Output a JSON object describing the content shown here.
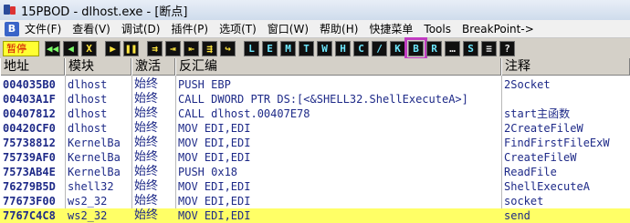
{
  "title": "15PBOD - dlhost.exe - [断点]",
  "menu": {
    "b_label": "B",
    "items": [
      "文件(F)",
      "查看(V)",
      "调试(D)",
      "插件(P)",
      "选项(T)",
      "窗口(W)",
      "帮助(H)",
      "快捷菜单",
      "Tools",
      "BreakPoint->"
    ]
  },
  "toolbar": {
    "status": "暂停",
    "buttons_left": [
      "◀◀",
      "◀",
      "X",
      "▶",
      "❚❚",
      "⇉",
      "⇥",
      "⇤",
      "⇶",
      "↪"
    ],
    "buttons_right": [
      "L",
      "E",
      "M",
      "T",
      "W",
      "H",
      "C",
      "/",
      "K",
      "B",
      "R",
      "…",
      "S",
      "≡",
      "?"
    ]
  },
  "table": {
    "headers": [
      "地址",
      "模块",
      "激活",
      "反汇编",
      "注释"
    ],
    "rows": [
      {
        "addr": "004035B0",
        "module": "dlhost",
        "active": "始终",
        "disasm": "PUSH EBP",
        "comment": "2Socket"
      },
      {
        "addr": "00403A1F",
        "module": "dlhost",
        "active": "始终",
        "disasm": "CALL DWORD PTR DS:[<&SHELL32.ShellExecuteA>]",
        "comment": ""
      },
      {
        "addr": "00407812",
        "module": "dlhost",
        "active": "始终",
        "disasm": "CALL dlhost.00407E78",
        "comment": "start主函数"
      },
      {
        "addr": "00420CF0",
        "module": "dlhost",
        "active": "始终",
        "disasm": "MOV EDI,EDI",
        "comment": "2CreateFileW"
      },
      {
        "addr": "75738812",
        "module": "KernelBa",
        "active": "始终",
        "disasm": "MOV EDI,EDI",
        "comment": "FindFirstFileExW"
      },
      {
        "addr": "75739AF0",
        "module": "KernelBa",
        "active": "始终",
        "disasm": "MOV EDI,EDI",
        "comment": "CreateFileW"
      },
      {
        "addr": "7573AB4E",
        "module": "KernelBa",
        "active": "始终",
        "disasm": "PUSH 0x18",
        "comment": "ReadFile"
      },
      {
        "addr": "76279B5D",
        "module": "shell32",
        "active": "始终",
        "disasm": "MOV EDI,EDI",
        "comment": "ShellExecuteA"
      },
      {
        "addr": "77673F00",
        "module": "ws2_32",
        "active": "始终",
        "disasm": "MOV EDI,EDI",
        "comment": "socket"
      },
      {
        "addr": "7767C4C8",
        "module": "ws2_32",
        "active": "始终",
        "disasm": "MOV EDI,EDI",
        "comment": "send"
      }
    ],
    "highlighted_row_index": 9
  },
  "colors": {
    "highlight_row": "#ffff66",
    "status_bg": "#ffff33",
    "selected_button_outline": "#c13cc1"
  }
}
